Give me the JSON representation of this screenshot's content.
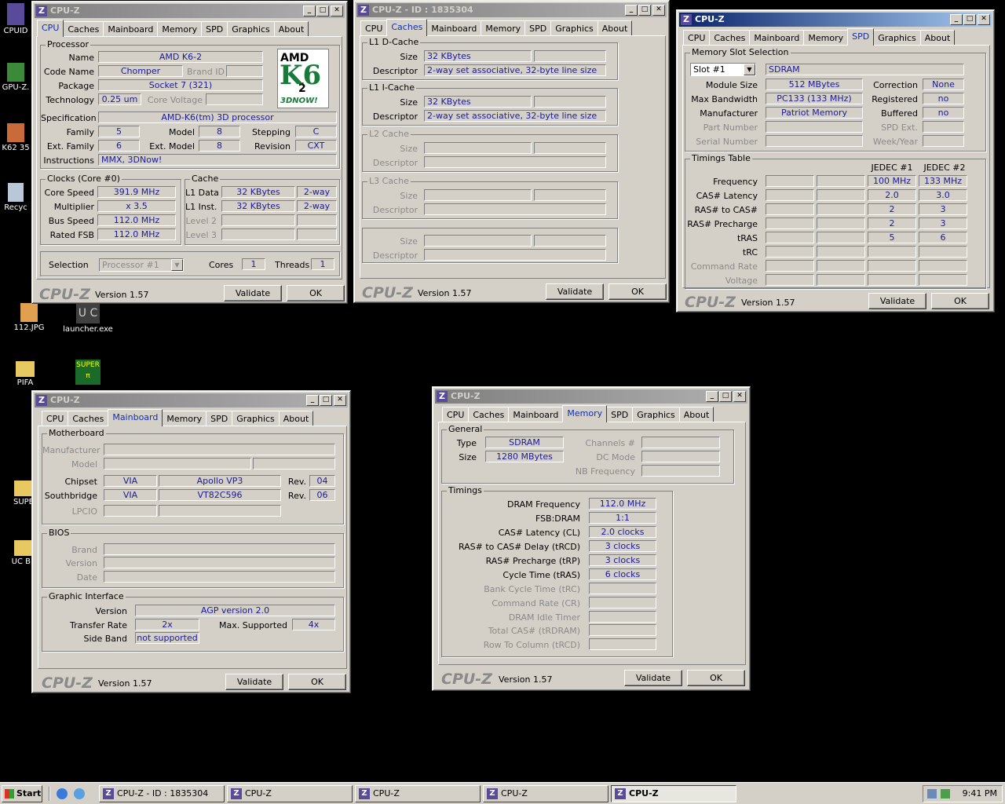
{
  "desktop": {
    "icons": [
      {
        "label": "CPUID"
      },
      {
        "label": "GPU-Z."
      },
      {
        "label": "K62 35"
      },
      {
        "label": "Recyc"
      },
      {
        "label": "112.JPG"
      },
      {
        "label": "launcher.exe"
      },
      {
        "label": "PIFA"
      },
      {
        "label": "SUPE"
      },
      {
        "label": "UC BE"
      }
    ]
  },
  "tabs": [
    "CPU",
    "Caches",
    "Mainboard",
    "Memory",
    "SPD",
    "Graphics",
    "About"
  ],
  "common": {
    "logo": "CPU-Z",
    "version": "Version 1.57",
    "validate": "Validate",
    "ok": "OK",
    "brand": "CPU-Z"
  },
  "win_cpu": {
    "title": "CPU-Z",
    "processor": {
      "legend": "Processor",
      "name_l": "Name",
      "name": "AMD K6-2",
      "code_l": "Code Name",
      "code": "Chomper",
      "brandid_l": "Brand ID",
      "package_l": "Package",
      "package": "Socket 7 (321)",
      "tech_l": "Technology",
      "tech": "0.25 um",
      "corev_l": "Core Voltage",
      "spec_l": "Specification",
      "spec": "AMD-K6(tm) 3D processor",
      "family_l": "Family",
      "family": "5",
      "model_l": "Model",
      "model": "8",
      "stepping_l": "Stepping",
      "stepping": "C",
      "extfam_l": "Ext. Family",
      "extfam": "6",
      "extmodel_l": "Ext. Model",
      "extmodel": "8",
      "revision_l": "Revision",
      "revision": "CXT",
      "instr_l": "Instructions",
      "instr": "MMX, 3DNow!"
    },
    "logo_text": {
      "amd": "AMD",
      "k6": "K6",
      "two": "2",
      "now": "3DNOW!"
    },
    "clocks": {
      "legend": "Clocks (Core #0)",
      "speed_l": "Core Speed",
      "speed": "391.9 MHz",
      "mult_l": "Multiplier",
      "mult": "x 3.5",
      "bus_l": "Bus Speed",
      "bus": "112.0 MHz",
      "fsb_l": "Rated FSB",
      "fsb": "112.0 MHz"
    },
    "cache": {
      "legend": "Cache",
      "l1d_l": "L1 Data",
      "l1d": "32 KBytes",
      "l1d_w": "2-way",
      "l1i_l": "L1 Inst.",
      "l1i": "32 KBytes",
      "l1i_w": "2-way",
      "l2_l": "Level 2",
      "l3_l": "Level 3"
    },
    "sel_l": "Selection",
    "sel": "Processor #1",
    "cores_l": "Cores",
    "cores": "1",
    "threads_l": "Threads",
    "threads": "1"
  },
  "win_caches": {
    "title": "CPU-Z - ID : 1835304",
    "l1d": {
      "legend": "L1 D-Cache",
      "size_l": "Size",
      "size": "32 KBytes",
      "desc_l": "Descriptor",
      "desc": "2-way set associative, 32-byte line size"
    },
    "l1i": {
      "legend": "L1 I-Cache",
      "size_l": "Size",
      "size": "32 KBytes",
      "desc_l": "Descriptor",
      "desc": "2-way set associative, 32-byte line size"
    },
    "l2": {
      "legend": "L2 Cache",
      "size_l": "Size",
      "desc_l": "Descriptor"
    },
    "l3": {
      "legend": "L3 Cache",
      "size_l": "Size",
      "desc_l": "Descriptor"
    },
    "x": {
      "size_l": "Size",
      "desc_l": "Descriptor"
    }
  },
  "win_spd": {
    "title": "CPU-Z",
    "slot": {
      "legend": "Memory Slot Selection",
      "sel": "Slot #1",
      "type": "SDRAM",
      "modsize_l": "Module Size",
      "modsize": "512 MBytes",
      "corr_l": "Correction",
      "corr": "None",
      "bw_l": "Max Bandwidth",
      "bw": "PC133 (133 MHz)",
      "reg_l": "Registered",
      "reg": "no",
      "manu_l": "Manufacturer",
      "manu": "Patriot Memory",
      "buf_l": "Buffered",
      "buf": "no",
      "part_l": "Part Number",
      "spdext_l": "SPD Ext.",
      "serial_l": "Serial Number",
      "week_l": "Week/Year"
    },
    "timings": {
      "legend": "Timings Table",
      "jedec1": "JEDEC #1",
      "jedec2": "JEDEC #2",
      "freq_l": "Frequency",
      "freq1": "100 MHz",
      "freq2": "133 MHz",
      "cas_l": "CAS# Latency",
      "cas1": "2.0",
      "cas2": "3.0",
      "rcd_l": "RAS# to CAS#",
      "rcd1": "2",
      "rcd2": "3",
      "rp_l": "RAS# Precharge",
      "rp1": "2",
      "rp2": "3",
      "tras_l": "tRAS",
      "tras1": "5",
      "tras2": "6",
      "trc_l": "tRC",
      "cr_l": "Command Rate",
      "volt_l": "Voltage"
    }
  },
  "win_mb": {
    "title": "CPU-Z",
    "mb": {
      "legend": "Motherboard",
      "manu_l": "Manufacturer",
      "model_l": "Model",
      "chipset_l": "Chipset",
      "chipset_v": "VIA",
      "chipset_n": "Apollo VP3",
      "rev_l": "Rev.",
      "chipset_r": "04",
      "sb_l": "Southbridge",
      "sb_v": "VIA",
      "sb_n": "VT82C596",
      "sb_r": "06",
      "lpcio_l": "LPCIO"
    },
    "bios": {
      "legend": "BIOS",
      "brand_l": "Brand",
      "version_l": "Version",
      "date_l": "Date"
    },
    "gi": {
      "legend": "Graphic Interface",
      "version_l": "Version",
      "version": "AGP version 2.0",
      "rate_l": "Transfer Rate",
      "rate": "2x",
      "max_l": "Max. Supported",
      "max": "4x",
      "sb_l": "Side Band",
      "sb": "not supported"
    }
  },
  "win_mem": {
    "title": "CPU-Z",
    "general": {
      "legend": "General",
      "type_l": "Type",
      "type": "SDRAM",
      "size_l": "Size",
      "size": "1280 MBytes",
      "ch_l": "Channels #",
      "dc_l": "DC Mode",
      "nb_l": "NB Frequency"
    },
    "timings": {
      "legend": "Timings",
      "freq_l": "DRAM Frequency",
      "freq": "112.0 MHz",
      "fsb_l": "FSB:DRAM",
      "fsb": "1:1",
      "cl_l": "CAS# Latency (CL)",
      "cl": "2.0 clocks",
      "rcd_l": "RAS# to CAS# Delay (tRCD)",
      "rcd": "3 clocks",
      "rp_l": "RAS# Precharge (tRP)",
      "rp": "3 clocks",
      "tras_l": "Cycle Time (tRAS)",
      "tras": "6 clocks",
      "trc_l": "Bank Cycle Time (tRC)",
      "cr_l": "Command Rate (CR)",
      "idle_l": "DRAM Idle Timer",
      "trdram_l": "Total CAS# (tRDRAM)",
      "rtc_l": "Row To Column (tRCD)"
    }
  },
  "taskbar": {
    "start": "Start",
    "items": [
      "CPU-Z - ID : 1835304",
      "CPU-Z",
      "CPU-Z",
      "CPU-Z",
      "CPU-Z"
    ],
    "clock": "9:41 PM"
  }
}
